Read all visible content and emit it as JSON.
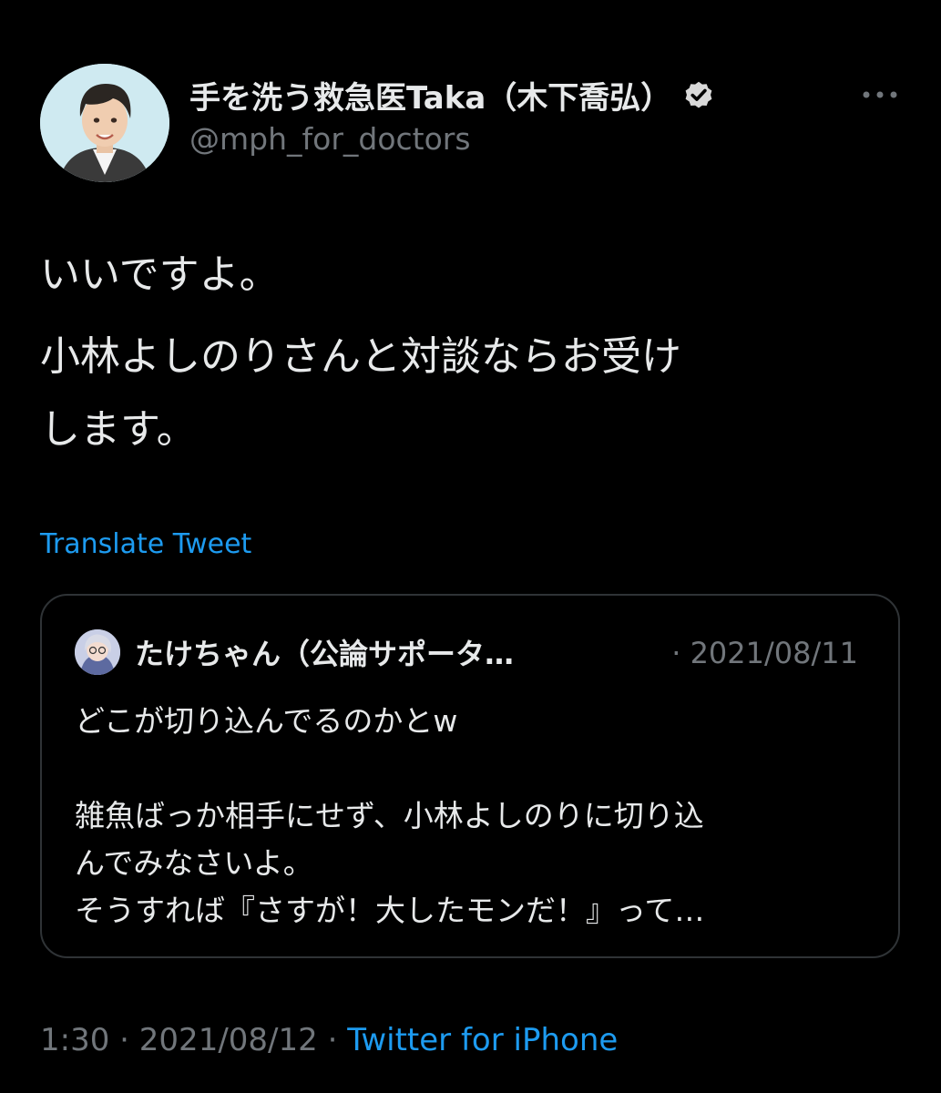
{
  "author": {
    "display_name": "手を洗う救急医Taka（木下喬弘）",
    "handle": "@mph_for_doctors",
    "verified": true,
    "avatar_icon": "doctor-portrait-avatar",
    "more_icon": "more-dots-icon"
  },
  "tweet": {
    "lines": [
      "いいですよ。",
      "小林よしのりさんと対談ならお受け",
      "します。"
    ],
    "translate_label": "Translate Tweet"
  },
  "quote": {
    "display_name": "たけちゃん（公論サポータ…",
    "separator": "·",
    "date": "2021/08/11",
    "lines": [
      "どこが切り込んでるのかとw",
      "",
      "雑魚ばっか相手にせず、小林よしのりに切り込",
      "んでみなさいよ。",
      "そうすれば『さすが！大したモンだ！』って…"
    ],
    "avatar_icon": "anime-avatar"
  },
  "meta": {
    "time": "1:30",
    "separator": "·",
    "date": "2021/08/12",
    "source": "Twitter for iPhone"
  },
  "colors": {
    "background": "#000000",
    "text": "#e7e9ea",
    "secondary": "#71767b",
    "link": "#1d9bf0",
    "border": "#2f3336"
  }
}
